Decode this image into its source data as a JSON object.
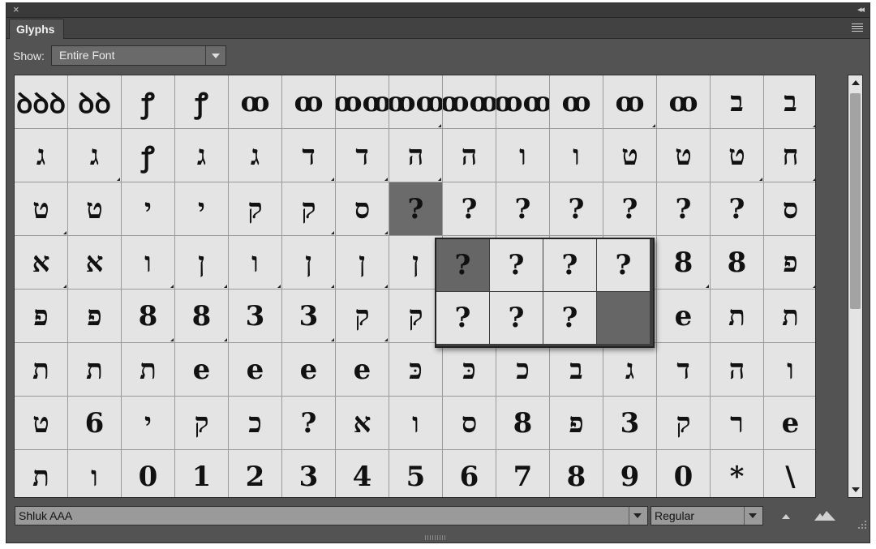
{
  "window": {
    "close_icon": "×",
    "collapse_icon": "◂◂"
  },
  "panel": {
    "title": "Glyphs"
  },
  "show": {
    "label": "Show:",
    "value": "Entire Font"
  },
  "font": {
    "family": "Shluk AAA",
    "style": "Regular"
  },
  "grid": {
    "rows": [
      [
        "ꝺꝺꝺ",
        "ꝺꝺ",
        "ꝭ",
        "ꝭ",
        "ꝏ",
        "ꝏ",
        "ꝏꝏ",
        "ꝏꝏ",
        "ꝏꝏ",
        "ꝏꝏ",
        "ꝏ",
        "ꝏ",
        "ꝏ",
        "ב",
        "ב"
      ],
      [
        "ג",
        "ג",
        "ꝭ",
        "ג",
        "ג",
        "ד",
        "ד",
        "ה",
        "ה",
        "ו",
        "ו",
        "ט",
        "ט",
        "ט",
        "ח"
      ],
      [
        "ט",
        "ט",
        "י",
        "י",
        "ק",
        "ק",
        "ס",
        "?",
        "?",
        "?",
        "?",
        "?",
        "?",
        "?",
        "ס"
      ],
      [
        "א",
        "א",
        "ו",
        "ן",
        "ו",
        "ן",
        "ן",
        "ן",
        "?",
        "?",
        "?",
        "?",
        "8",
        "8",
        "פ"
      ],
      [
        "פ",
        "פ",
        "8",
        "8",
        "3",
        "3",
        "ק",
        "ק",
        "",
        "",
        "",
        "",
        "e",
        "ת",
        "ת"
      ],
      [
        "ת",
        "ת",
        "ת",
        "e",
        "e",
        "e",
        "e",
        "כּ",
        "כּ",
        "כ",
        "ב",
        "ג",
        "ד",
        "ה",
        "ו"
      ],
      [
        "ט",
        "6",
        "י",
        "ק",
        "כ",
        "?",
        "א",
        "ו",
        "ס",
        "8",
        "פ",
        "3",
        "ק",
        "ר",
        "e"
      ],
      [
        "ת",
        "ו",
        "0",
        "1",
        "2",
        "3",
        "4",
        "5",
        "6",
        "7",
        "8",
        "9",
        "0",
        "*",
        "\\"
      ]
    ],
    "selected": {
      "row": 2,
      "col": 7
    }
  },
  "popup": {
    "glyphs": [
      "?",
      "?",
      "?",
      "?",
      "?",
      "?",
      "?",
      ""
    ]
  }
}
